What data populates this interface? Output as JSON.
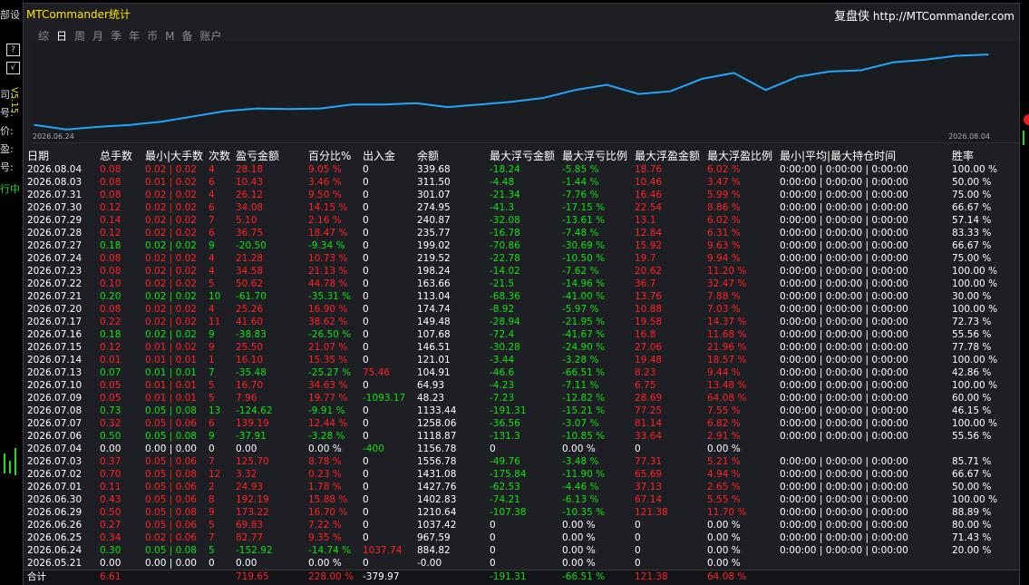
{
  "window": {
    "title": "MTCommander统计",
    "site_prefix": "复盘侠",
    "site_url": "http://MTCommander.com",
    "tabs": [
      {
        "label": "综",
        "active": false
      },
      {
        "label": "日",
        "active": true
      },
      {
        "label": "周",
        "active": false
      },
      {
        "label": "月",
        "active": false
      },
      {
        "label": "季",
        "active": false
      },
      {
        "label": "年",
        "active": false
      },
      {
        "label": "币",
        "active": false
      },
      {
        "label": "M",
        "active": false
      },
      {
        "label": "备",
        "active": false
      },
      {
        "label": "账户",
        "active": false
      }
    ]
  },
  "sidebar": {
    "labels": [
      "司:",
      "号:",
      "价:",
      "盈:",
      "号:"
    ],
    "green_label": "行中",
    "top_label": "部设",
    "version": "V5.15",
    "tool_icons": [
      "help-icon",
      "check-icon"
    ]
  },
  "chart_data": {
    "type": "line",
    "x_start_label": "2026.06.24",
    "x_end_label": "2026.08.04",
    "x": [
      "2026.06.24",
      "2026.06.25",
      "2026.06.26",
      "2026.06.29",
      "2026.06.30",
      "2026.07.01",
      "2026.07.02",
      "2026.07.03",
      "2026.07.04",
      "2026.07.06",
      "2026.07.07",
      "2026.07.08",
      "2026.07.09",
      "2026.07.10",
      "2026.07.13",
      "2026.07.14",
      "2026.07.15",
      "2026.07.16",
      "2026.07.17",
      "2026.07.20",
      "2026.07.21",
      "2026.07.22",
      "2026.07.23",
      "2026.07.24",
      "2026.07.27",
      "2026.07.28",
      "2026.07.29",
      "2026.07.30",
      "2026.07.31",
      "2026.08.03",
      "2026.08.04"
    ],
    "series": [
      {
        "values": [
          5,
          -2,
          2,
          5,
          10,
          18,
          26,
          30,
          29,
          30,
          36,
          36,
          38,
          32,
          36,
          40,
          46,
          58,
          66,
          52,
          56,
          75,
          84,
          58,
          78,
          86,
          88,
          100,
          104,
          110,
          112
        ]
      }
    ],
    "ylim": [
      -5,
      130
    ],
    "color": "#1ea7ff"
  },
  "table": {
    "headers": [
      "日期",
      "总手数",
      "最小|大手数",
      "次数",
      "盈亏金额",
      "百分比%",
      "出入金",
      "余额",
      "最大浮亏金额",
      "最大浮亏比例",
      "最大浮盈金额",
      "最大浮盈比例",
      "最小|平均|最大持仓时间",
      "胜率"
    ],
    "rows": [
      {
        "date": "2026.08.04",
        "lots": "0.08",
        "minmax": "0.02 | 0.02",
        "count": "4",
        "pnl": "28.18",
        "pct": "9.05 %",
        "flow": "0",
        "balance": "339.68",
        "mfl": "-18.24",
        "mflp": "-5.85 %",
        "mfp": "18.76",
        "mfpp": "6.02 %",
        "hold": "0:00:00 | 0:00:00 | 0:00:00",
        "win": "100.00 %",
        "c": "r"
      },
      {
        "date": "2026.08.03",
        "lots": "0.08",
        "minmax": "0.01 | 0.02",
        "count": "6",
        "pnl": "10.43",
        "pct": "3.46 %",
        "flow": "0",
        "balance": "311.50",
        "mfl": "-4.48",
        "mflp": "-1.44 %",
        "mfp": "10.46",
        "mfpp": "3.47 %",
        "hold": "0:00:00 | 0:00:00 | 0:00:00",
        "win": "50.00 %",
        "c": "r"
      },
      {
        "date": "2026.07.31",
        "lots": "0.08",
        "minmax": "0.02 | 0.02",
        "count": "4",
        "pnl": "26.12",
        "pct": "9.50 %",
        "flow": "0",
        "balance": "301.07",
        "mfl": "-21.34",
        "mflp": "-7.76 %",
        "mfp": "16.46",
        "mfpp": "5.99 %",
        "hold": "0:00:00 | 0:00:00 | 0:00:00",
        "win": "75.00 %",
        "c": "r"
      },
      {
        "date": "2026.07.30",
        "lots": "0.12",
        "minmax": "0.02 | 0.02",
        "count": "6",
        "pnl": "34.08",
        "pct": "14.15 %",
        "flow": "0",
        "balance": "274.95",
        "mfl": "-41.3",
        "mflp": "-17.15 %",
        "mfp": "22.54",
        "mfpp": "8.86 %",
        "hold": "0:00:00 | 0:00:00 | 0:00:00",
        "win": "66.67 %",
        "c": "r"
      },
      {
        "date": "2026.07.29",
        "lots": "0.14",
        "minmax": "0.02 | 0.02",
        "count": "7",
        "pnl": "5.10",
        "pct": "2.16 %",
        "flow": "0",
        "balance": "240.87",
        "mfl": "-32.08",
        "mflp": "-13.61 %",
        "mfp": "13.1",
        "mfpp": "6.02 %",
        "hold": "0:00:00 | 0:00:00 | 0:00:00",
        "win": "57.14 %",
        "c": "r"
      },
      {
        "date": "2026.07.28",
        "lots": "0.12",
        "minmax": "0.02 | 0.02",
        "count": "6",
        "pnl": "36.75",
        "pct": "18.47 %",
        "flow": "0",
        "balance": "235.77",
        "mfl": "-16.78",
        "mflp": "-7.48 %",
        "mfp": "12.84",
        "mfpp": "6.31 %",
        "hold": "0:00:00 | 0:00:00 | 0:00:00",
        "win": "83.33 %",
        "c": "r"
      },
      {
        "date": "2026.07.27",
        "lots": "0.18",
        "minmax": "0.02 | 0.02",
        "count": "9",
        "pnl": "-20.50",
        "pct": "-9.34 %",
        "flow": "0",
        "balance": "199.02",
        "mfl": "-70.86",
        "mflp": "-30.69 %",
        "mfp": "15.92",
        "mfpp": "9.63 %",
        "hold": "0:00:00 | 0:00:00 | 0:00:00",
        "win": "66.67 %",
        "c": "g"
      },
      {
        "date": "2026.07.24",
        "lots": "0.08",
        "minmax": "0.02 | 0.02",
        "count": "4",
        "pnl": "21.28",
        "pct": "10.73 %",
        "flow": "0",
        "balance": "219.52",
        "mfl": "-22.78",
        "mflp": "-10.50 %",
        "mfp": "19.7",
        "mfpp": "9.94 %",
        "hold": "0:00:00 | 0:00:00 | 0:00:00",
        "win": "75.00 %",
        "c": "r"
      },
      {
        "date": "2026.07.23",
        "lots": "0.08",
        "minmax": "0.02 | 0.02",
        "count": "4",
        "pnl": "34.58",
        "pct": "21.13 %",
        "flow": "0",
        "balance": "198.24",
        "mfl": "-14.02",
        "mflp": "-7.62 %",
        "mfp": "20.62",
        "mfpp": "11.20 %",
        "hold": "0:00:00 | 0:00:00 | 0:00:00",
        "win": "100.00 %",
        "c": "r"
      },
      {
        "date": "2026.07.22",
        "lots": "0.10",
        "minmax": "0.02 | 0.02",
        "count": "5",
        "pnl": "50.62",
        "pct": "44.78 %",
        "flow": "0",
        "balance": "163.66",
        "mfl": "-21.5",
        "mflp": "-14.96 %",
        "mfp": "36.7",
        "mfpp": "32.47 %",
        "hold": "0:00:00 | 0:00:00 | 0:00:00",
        "win": "100.00 %",
        "c": "r"
      },
      {
        "date": "2026.07.21",
        "lots": "0.20",
        "minmax": "0.02 | 0.02",
        "count": "10",
        "pnl": "-61.70",
        "pct": "-35.31 %",
        "flow": "0",
        "balance": "113.04",
        "mfl": "-68.36",
        "mflp": "-41.00 %",
        "mfp": "13.76",
        "mfpp": "7.88 %",
        "hold": "0:00:00 | 0:00:00 | 0:00:00",
        "win": "30.00 %",
        "c": "g"
      },
      {
        "date": "2026.07.20",
        "lots": "0.08",
        "minmax": "0.02 | 0.02",
        "count": "4",
        "pnl": "25.26",
        "pct": "16.90 %",
        "flow": "0",
        "balance": "174.74",
        "mfl": "-8.92",
        "mflp": "-5.97 %",
        "mfp": "10.88",
        "mfpp": "7.03 %",
        "hold": "0:00:00 | 0:00:00 | 0:00:00",
        "win": "100.00 %",
        "c": "r"
      },
      {
        "date": "2026.07.17",
        "lots": "0.22",
        "minmax": "0.02 | 0.02",
        "count": "11",
        "pnl": "41.60",
        "pct": "38.62 %",
        "flow": "0",
        "balance": "149.48",
        "mfl": "-28.94",
        "mflp": "-21.95 %",
        "mfp": "19.58",
        "mfpp": "14.37 %",
        "hold": "0:00:00 | 0:00:00 | 0:00:00",
        "win": "72.73 %",
        "c": "r"
      },
      {
        "date": "2026.07.16",
        "lots": "0.18",
        "minmax": "0.02 | 0.02",
        "count": "9",
        "pnl": "-38.83",
        "pct": "-26.50 %",
        "flow": "0",
        "balance": "107.68",
        "mfl": "-72.4",
        "mflp": "-41.67 %",
        "mfp": "16.8",
        "mfpp": "11.68 %",
        "hold": "0:00:00 | 0:00:00 | 0:00:00",
        "win": "55.56 %",
        "c": "g"
      },
      {
        "date": "2026.07.15",
        "lots": "0.12",
        "minmax": "0.01 | 0.02",
        "count": "9",
        "pnl": "25.50",
        "pct": "21.07 %",
        "flow": "0",
        "balance": "146.51",
        "mfl": "-30.28",
        "mflp": "-24.90 %",
        "mfp": "27.06",
        "mfpp": "21.96 %",
        "hold": "0:00:00 | 0:00:00 | 0:00:00",
        "win": "77.78 %",
        "c": "r"
      },
      {
        "date": "2026.07.14",
        "lots": "0.01",
        "minmax": "0.01 | 0.01",
        "count": "1",
        "pnl": "16.10",
        "pct": "15.35 %",
        "flow": "0",
        "balance": "121.01",
        "mfl": "-3.44",
        "mflp": "-3.28 %",
        "mfp": "19.48",
        "mfpp": "18.57 %",
        "hold": "0:00:00 | 0:00:00 | 0:00:00",
        "win": "100.00 %",
        "c": "r"
      },
      {
        "date": "2026.07.13",
        "lots": "0.07",
        "minmax": "0.01 | 0.01",
        "count": "7",
        "pnl": "-35.48",
        "pct": "-25.27 %",
        "flow": "75.46",
        "balance": "104.91",
        "mfl": "-46.6",
        "mflp": "-66.51 %",
        "mfp": "8.23",
        "mfpp": "9.44 %",
        "hold": "0:00:00 | 0:00:00 | 0:00:00",
        "win": "42.86 %",
        "c": "g",
        "flowc": "r"
      },
      {
        "date": "2026.07.10",
        "lots": "0.05",
        "minmax": "0.01 | 0.01",
        "count": "5",
        "pnl": "16.70",
        "pct": "34.63 %",
        "flow": "0",
        "balance": "64.93",
        "mfl": "-4.23",
        "mflp": "-7.11 %",
        "mfp": "6.75",
        "mfpp": "13.48 %",
        "hold": "0:00:00 | 0:00:00 | 0:00:00",
        "win": "100.00 %",
        "c": "r"
      },
      {
        "date": "2026.07.09",
        "lots": "0.05",
        "minmax": "0.01 | 0.01",
        "count": "5",
        "pnl": "7.96",
        "pct": "19.77 %",
        "flow": "-1093.17",
        "balance": "48.23",
        "mfl": "-7.23",
        "mflp": "-12.82 %",
        "mfp": "28.69",
        "mfpp": "64.08 %",
        "hold": "0:00:00 | 0:00:00 | 0:00:00",
        "win": "60.00 %",
        "c": "r",
        "flowc": "g"
      },
      {
        "date": "2026.07.08",
        "lots": "0.73",
        "minmax": "0.05 | 0.08",
        "count": "13",
        "pnl": "-124.62",
        "pct": "-9.91 %",
        "flow": "0",
        "balance": "1133.44",
        "mfl": "-191.31",
        "mflp": "-15.21 %",
        "mfp": "77.25",
        "mfpp": "7.55 %",
        "hold": "0:00:00 | 0:00:00 | 0:00:00",
        "win": "46.15 %",
        "c": "g"
      },
      {
        "date": "2026.07.07",
        "lots": "0.32",
        "minmax": "0.05 | 0.06",
        "count": "6",
        "pnl": "139.19",
        "pct": "12.44 %",
        "flow": "0",
        "balance": "1258.06",
        "mfl": "-36.56",
        "mflp": "-3.07 %",
        "mfp": "81.14",
        "mfpp": "6.82 %",
        "hold": "0:00:00 | 0:00:00 | 0:00:00",
        "win": "100.00 %",
        "c": "r"
      },
      {
        "date": "2026.07.06",
        "lots": "0.50",
        "minmax": "0.05 | 0.08",
        "count": "9",
        "pnl": "-37.91",
        "pct": "-3.28 %",
        "flow": "0",
        "balance": "1118.87",
        "mfl": "-131.3",
        "mflp": "-10.85 %",
        "mfp": "33.64",
        "mfpp": "2.91 %",
        "hold": "0:00:00 | 0:00:00 | 0:00:00",
        "win": "55.56 %",
        "c": "g"
      },
      {
        "date": "2026.07.04",
        "lots": "0.00",
        "minmax": "0.00 | 0.00",
        "count": "0",
        "pnl": "0.00",
        "pct": "0.00 %",
        "flow": "-400",
        "balance": "1156.78",
        "mfl": "0",
        "mflp": "0.00 %",
        "mfp": "0",
        "mfpp": "0.00 %",
        "hold": "",
        "win": "",
        "c": "w",
        "flowc": "g"
      },
      {
        "date": "2026.07.03",
        "lots": "0.37",
        "minmax": "0.05 | 0.06",
        "count": "7",
        "pnl": "125.70",
        "pct": "8.78 %",
        "flow": "0",
        "balance": "1556.78",
        "mfl": "-49.76",
        "mflp": "-3.48 %",
        "mfp": "77.31",
        "mfpp": "5.21 %",
        "hold": "0:00:00 | 0:00:00 | 0:00:00",
        "win": "85.71 %",
        "c": "r"
      },
      {
        "date": "2026.07.02",
        "lots": "0.70",
        "minmax": "0.05 | 0.08",
        "count": "12",
        "pnl": "3.32",
        "pct": "0.23 %",
        "flow": "0",
        "balance": "1431.08",
        "mfl": "-175.84",
        "mflp": "-11.90 %",
        "mfp": "65.69",
        "mfpp": "4.94 %",
        "hold": "0:00:00 | 0:00:00 | 0:00:00",
        "win": "66.67 %",
        "c": "r"
      },
      {
        "date": "2026.07.01",
        "lots": "0.11",
        "minmax": "0.05 | 0.06",
        "count": "2",
        "pnl": "24.93",
        "pct": "1.78 %",
        "flow": "0",
        "balance": "1427.76",
        "mfl": "-62.53",
        "mflp": "-4.46 %",
        "mfp": "37.13",
        "mfpp": "2.65 %",
        "hold": "0:00:00 | 0:00:00 | 0:00:00",
        "win": "50.00 %",
        "c": "r"
      },
      {
        "date": "2026.06.30",
        "lots": "0.43",
        "minmax": "0.05 | 0.06",
        "count": "8",
        "pnl": "192.19",
        "pct": "15.88 %",
        "flow": "0",
        "balance": "1402.83",
        "mfl": "-74.21",
        "mflp": "-6.13 %",
        "mfp": "67.14",
        "mfpp": "5.55 %",
        "hold": "0:00:00 | 0:00:00 | 0:00:00",
        "win": "100.00 %",
        "c": "r"
      },
      {
        "date": "2026.06.29",
        "lots": "0.50",
        "minmax": "0.05 | 0.08",
        "count": "9",
        "pnl": "173.22",
        "pct": "16.70 %",
        "flow": "0",
        "balance": "1210.64",
        "mfl": "-107.38",
        "mflp": "-10.35 %",
        "mfp": "121.38",
        "mfpp": "11.70 %",
        "hold": "0:00:00 | 0:00:00 | 0:00:00",
        "win": "88.89 %",
        "c": "r"
      },
      {
        "date": "2026.06.26",
        "lots": "0.27",
        "minmax": "0.05 | 0.06",
        "count": "5",
        "pnl": "69.83",
        "pct": "7.22 %",
        "flow": "0",
        "balance": "1037.42",
        "mfl": "0",
        "mflp": "0.00 %",
        "mfp": "0",
        "mfpp": "0.00 %",
        "hold": "0:00:00 | 0:00:00 | 0:00:00",
        "win": "80.00 %",
        "c": "r"
      },
      {
        "date": "2026.06.25",
        "lots": "0.34",
        "minmax": "0.02 | 0.06",
        "count": "7",
        "pnl": "82.77",
        "pct": "9.35 %",
        "flow": "0",
        "balance": "967.59",
        "mfl": "0",
        "mflp": "0.00 %",
        "mfp": "0",
        "mfpp": "0.00 %",
        "hold": "0:00:00 | 0:00:00 | 0:00:00",
        "win": "71.43 %",
        "c": "r"
      },
      {
        "date": "2026.06.24",
        "lots": "0.30",
        "minmax": "0.05 | 0.08",
        "count": "5",
        "pnl": "-152.92",
        "pct": "-14.74 %",
        "flow": "1037.74",
        "balance": "884.82",
        "mfl": "0",
        "mflp": "0.00 %",
        "mfp": "0",
        "mfpp": "0.00 %",
        "hold": "0:00:00 | 0:00:00 | 0:00:00",
        "win": "20.00 %",
        "c": "g",
        "flowc": "r"
      },
      {
        "date": "2026.05.21",
        "lots": "0.00",
        "minmax": "0.00 | 0.00",
        "count": "0",
        "pnl": "0.00",
        "pct": "0.00 %",
        "flow": "0",
        "balance": "-0.00",
        "mfl": "0",
        "mflp": "0.00 %",
        "mfp": "0",
        "mfpp": "0.00 %",
        "hold": "",
        "win": "",
        "c": "w"
      }
    ],
    "total": {
      "label": "合计",
      "lots": "6.61",
      "pnl": "719.65",
      "pct": "228.00 %",
      "flow": "-379.97",
      "mfl": "-191.31",
      "mflp": "-66.51 %",
      "mfp": "121.38",
      "mfpp": "64.08 %"
    }
  }
}
